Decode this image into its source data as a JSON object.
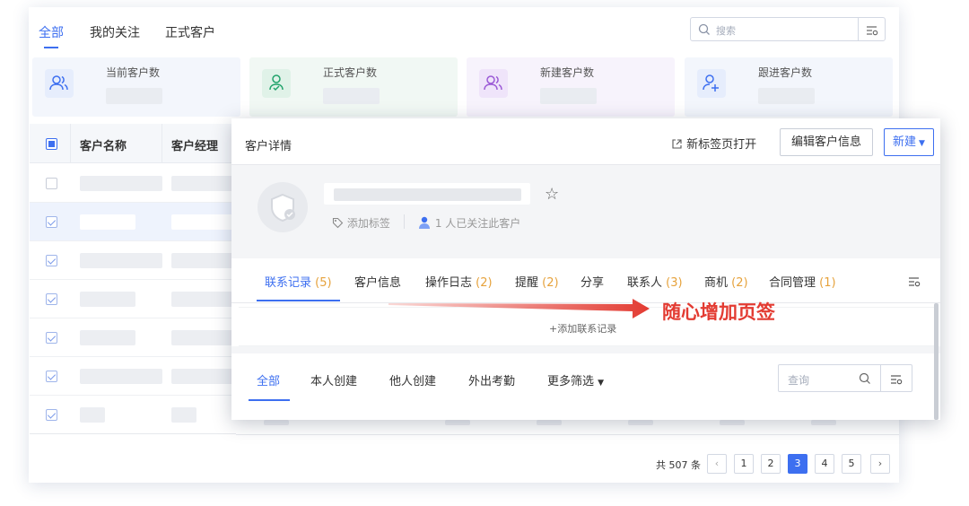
{
  "top_tabs": [
    "全部",
    "我的关注",
    "正式客户"
  ],
  "search_placeholder": "搜索",
  "stats": [
    {
      "label": "当前客户数",
      "icon": "users-icon",
      "color": "#3d6ff0",
      "bg": "#eef3fd"
    },
    {
      "label": "正式客户数",
      "icon": "user-check-icon",
      "color": "#21a36b",
      "bg": "#eaf7f0"
    },
    {
      "label": "新建客户数",
      "icon": "users-new-icon",
      "color": "#9b59d6",
      "bg": "#f3edfb"
    },
    {
      "label": "跟进客户数",
      "icon": "user-plus-icon",
      "color": "#3d6ff0",
      "bg": "#eef3fd"
    }
  ],
  "table": {
    "headers": [
      "客户名称",
      "客户经理"
    ]
  },
  "pagination": {
    "total": "共 507 条",
    "pages": [
      "1",
      "2",
      "3",
      "4",
      "5"
    ],
    "current": "3"
  },
  "modal": {
    "title": "客户详情",
    "open_new_tab": "新标签页打开",
    "edit_button": "编辑客户信息",
    "new_button": "新建",
    "add_tag": "添加标签",
    "followers": "1 人已关注此客户",
    "tabs": [
      {
        "label": "联系记录",
        "count": "(5)"
      },
      {
        "label": "客户信息",
        "count": ""
      },
      {
        "label": "操作日志",
        "count": "(2)"
      },
      {
        "label": "提醒",
        "count": "(2)"
      },
      {
        "label": "分享",
        "count": ""
      },
      {
        "label": "联系人",
        "count": "(3)"
      },
      {
        "label": "商机",
        "count": "(2)"
      },
      {
        "label": "合同管理",
        "count": "(1)"
      }
    ],
    "add_record": "+添加联系记录",
    "filter_tabs": [
      "全部",
      "本人创建",
      "他人创建",
      "外出考勤",
      "更多筛选"
    ],
    "query_placeholder": "查询"
  },
  "annotation": "随心增加页签",
  "colors": {
    "accent": "#3d6ff0",
    "annotation": "#e33b32",
    "count": "#e6a23c"
  }
}
